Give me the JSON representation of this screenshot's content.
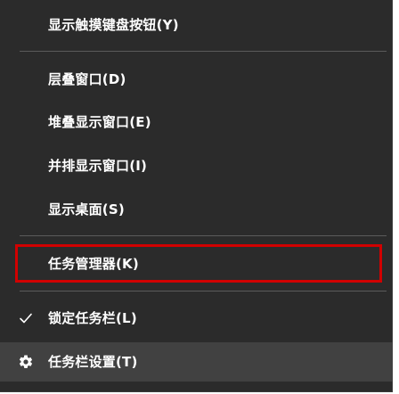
{
  "menu": {
    "items": [
      {
        "label": "显示触摸键盘按钮(Y)"
      },
      {
        "label": "层叠窗口(D)"
      },
      {
        "label": "堆叠显示窗口(E)"
      },
      {
        "label": "并排显示窗口(I)"
      },
      {
        "label": "显示桌面(S)"
      },
      {
        "label": "任务管理器(K)"
      },
      {
        "label": "锁定任务栏(L)",
        "icon": "checkmark-icon"
      },
      {
        "label": "任务栏设置(T)",
        "icon": "gear-icon"
      }
    ]
  },
  "colors": {
    "menu_background": "#2b2b2b",
    "text": "#ffffff",
    "separator": "#5b5b5b",
    "highlight_border": "#d10000",
    "hover_background": "#414141"
  }
}
